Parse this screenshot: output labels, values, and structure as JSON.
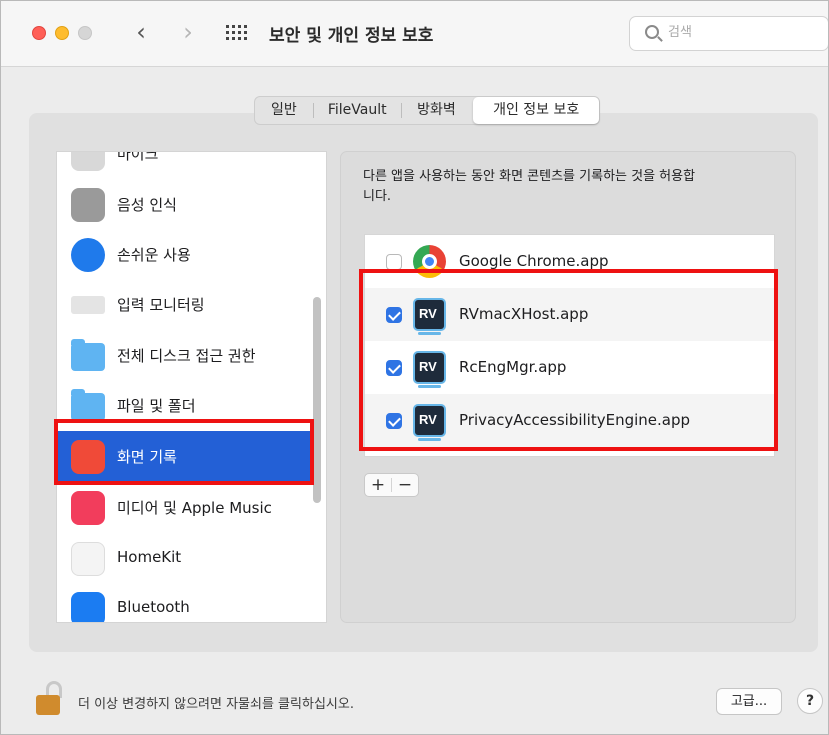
{
  "window": {
    "title": "보안 및 개인 정보 보호",
    "search_placeholder": "검색"
  },
  "tabs": [
    {
      "label": "일반"
    },
    {
      "label": "FileVault"
    },
    {
      "label": "방화벽"
    },
    {
      "label": "개인 정보 보호",
      "selected": true
    }
  ],
  "sidebar": {
    "items": [
      {
        "label": "마이크",
        "icon": "microphone-icon"
      },
      {
        "label": "음성 인식",
        "icon": "speech-recognition-icon"
      },
      {
        "label": "손쉬운 사용",
        "icon": "accessibility-icon"
      },
      {
        "label": "입력 모니터링",
        "icon": "keyboard-icon"
      },
      {
        "label": "전체 디스크 접근 권한",
        "icon": "folder-icon"
      },
      {
        "label": "파일 및 폴더",
        "icon": "folder-icon"
      },
      {
        "label": "화면 기록",
        "icon": "screen-recording-icon",
        "selected": true
      },
      {
        "label": "미디어 및 Apple Music",
        "icon": "music-icon"
      },
      {
        "label": "HomeKit",
        "icon": "home-icon"
      },
      {
        "label": "Bluetooth",
        "icon": "bluetooth-icon"
      }
    ]
  },
  "detail": {
    "description": "다른 앱을 사용하는 동안 화면 콘텐츠를 기록하는 것을 허용합니다.",
    "apps": [
      {
        "name": "Google Chrome.app",
        "checked": false,
        "icon": "chrome-icon"
      },
      {
        "name": "RVmacXHost.app",
        "checked": true,
        "icon": "rv-icon",
        "icon_text": "RV"
      },
      {
        "name": "RcEngMgr.app",
        "checked": true,
        "icon": "rv-icon",
        "icon_text": "RV"
      },
      {
        "name": "PrivacyAccessibilityEngine.app",
        "checked": true,
        "icon": "rv-icon",
        "icon_text": "RV"
      }
    ],
    "add_label": "+",
    "remove_label": "−"
  },
  "footer": {
    "lock_text": "더 이상 변경하지 않으려면 자물쇠를 클릭하십시오.",
    "advanced_label": "고급...",
    "help_label": "?"
  },
  "colors": {
    "selection": "#2360d6",
    "highlight_box": "#ee1111",
    "checkbox": "#2f74e4"
  }
}
